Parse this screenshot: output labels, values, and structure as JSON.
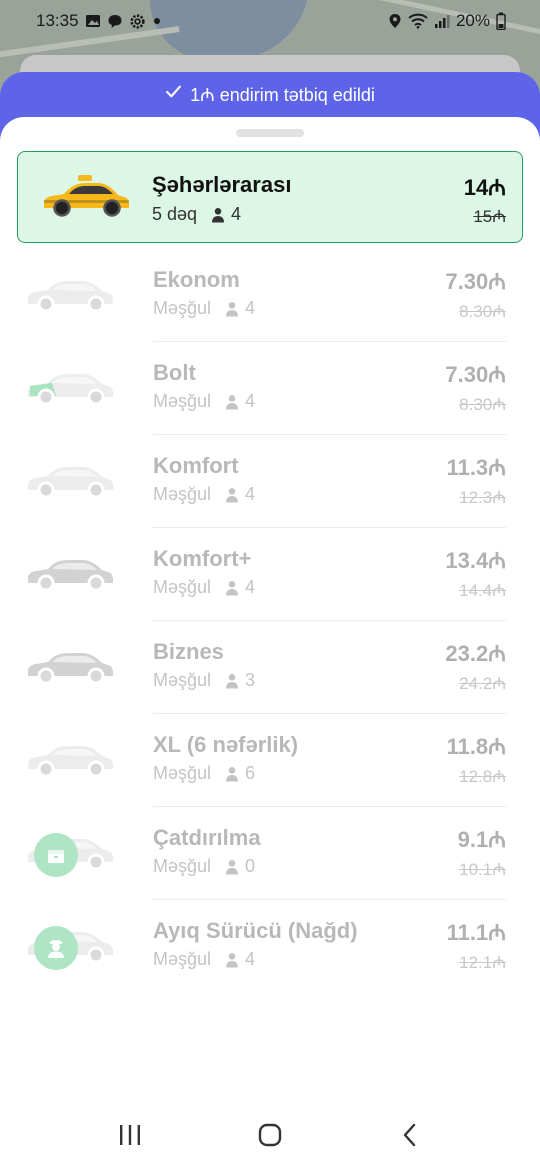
{
  "status_bar": {
    "time": "13:35",
    "battery": "20%",
    "left_icons": [
      "image-icon",
      "message-icon",
      "settings-icon",
      "dot-icon"
    ],
    "right_icons": [
      "location-icon",
      "wifi-icon",
      "signal-icon",
      "battery-icon"
    ]
  },
  "discount_banner": {
    "check_icon": "check-icon",
    "text": "1₼ endirim tətbiq edildi",
    "color": "#5d64e8"
  },
  "rides": [
    {
      "id": "seherlerarasi",
      "name": "Şəhərlərarası",
      "status": "5 dəq",
      "seats": "4",
      "price": "14₼",
      "old_price": "15₼",
      "selected": true,
      "icon": "taxi-car-icon",
      "car_color": "#f6b81a"
    },
    {
      "id": "ekonom",
      "name": "Ekonom",
      "status": "Məşğul",
      "seats": "4",
      "price": "7.30₼",
      "old_price": "8.30₼",
      "selected": false,
      "icon": "car-icon"
    },
    {
      "id": "bolt",
      "name": "Bolt",
      "status": "Məşğul",
      "seats": "4",
      "price": "7.30₼",
      "old_price": "8.30₼",
      "selected": false,
      "icon": "car-icon"
    },
    {
      "id": "komfort",
      "name": "Komfort",
      "status": "Məşğul",
      "seats": "4",
      "price": "11.3₼",
      "old_price": "12.3₼",
      "selected": false,
      "icon": "car-icon"
    },
    {
      "id": "komfort-plus",
      "name": "Komfort+",
      "status": "Məşğul",
      "seats": "4",
      "price": "13.4₼",
      "old_price": "14.4₼",
      "selected": false,
      "icon": "car-icon"
    },
    {
      "id": "biznes",
      "name": "Biznes",
      "status": "Məşğul",
      "seats": "3",
      "price": "23.2₼",
      "old_price": "24.2₼",
      "selected": false,
      "icon": "car-icon"
    },
    {
      "id": "xl",
      "name": "XL (6 nəfərlik)",
      "status": "Məşğul",
      "seats": "6",
      "price": "11.8₼",
      "old_price": "12.8₼",
      "selected": false,
      "icon": "van-icon"
    },
    {
      "id": "catdirilma",
      "name": "Çatdırılma",
      "status": "Məşğul",
      "seats": "0",
      "price": "9.1₼",
      "old_price": "10.1₼",
      "selected": false,
      "icon": "delivery-box-icon"
    },
    {
      "id": "ayiq-surucu",
      "name": "Ayıq Sürücü (Nağd)",
      "status": "Məşğul",
      "seats": "4",
      "price": "11.1₼",
      "old_price": "12.1₼",
      "selected": false,
      "icon": "driver-icon"
    }
  ],
  "nav_bar": {
    "buttons": [
      "recent-apps-icon",
      "home-icon",
      "back-icon"
    ]
  },
  "colors": {
    "selected_bg": "#dcf7e6",
    "selected_border": "#2a9d63",
    "accent": "#5d64e8"
  }
}
